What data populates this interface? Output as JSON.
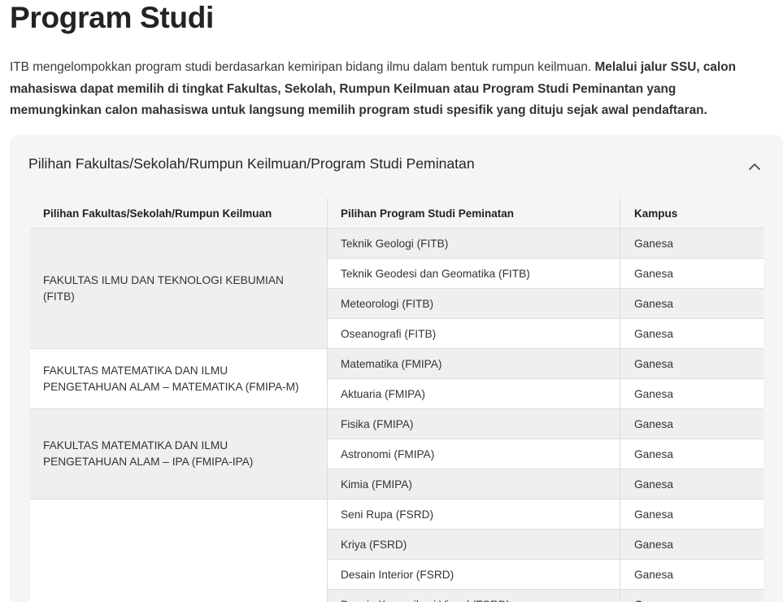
{
  "page_title": "Program Studi",
  "intro": {
    "normal": "ITB mengelompokkan program studi berdasarkan kemiripan bidang ilmu dalam bentuk rumpun keilmuan. ",
    "bold": "Melalui jalur SSU, calon mahasiswa dapat memilih di tingkat Fakultas, Sekolah, Rumpun Keilmuan atau Program Studi Peminantan yang memungkinkan calon mahasiswa untuk langsung memilih program studi spesifik yang dituju sejak awal pendaftaran."
  },
  "accordion": {
    "title": "Pilihan Fakultas/Sekolah/Rumpun Keilmuan/Program Studi Peminatan",
    "toggle_icon": "chevron-up-icon",
    "expanded": true
  },
  "table": {
    "headers": [
      "Pilihan Fakultas/Sekolah/Rumpun Keilmuan",
      "Pilihan Program Studi Peminatan",
      "Kampus"
    ],
    "faculties": [
      "FAKULTAS ILMU DAN TEKNOLOGI KEBUMIAN (FITB)",
      "FAKULTAS MATEMATIKA DAN ILMU PENGETAHUAN ALAM – MATEMATIKA (FMIPA-M)",
      "FAKULTAS MATEMATIKA DAN ILMU PENGETAHUAN ALAM – IPA (FMIPA-IPA)",
      ""
    ],
    "rows": [
      {
        "program": "Teknik Geologi (FITB)",
        "campus": "Ganesa"
      },
      {
        "program": "Teknik Geodesi dan Geomatika (FITB)",
        "campus": "Ganesa"
      },
      {
        "program": "Meteorologi (FITB)",
        "campus": "Ganesa"
      },
      {
        "program": "Oseanografi (FITB)",
        "campus": "Ganesa"
      },
      {
        "program": "Matematika (FMIPA)",
        "campus": "Ganesa"
      },
      {
        "program": "Aktuaria (FMIPA)",
        "campus": "Ganesa"
      },
      {
        "program": "Fisika (FMIPA)",
        "campus": "Ganesa"
      },
      {
        "program": "Astronomi (FMIPA)",
        "campus": "Ganesa"
      },
      {
        "program": "Kimia (FMIPA)",
        "campus": "Ganesa"
      },
      {
        "program": "Seni Rupa (FSRD)",
        "campus": "Ganesa"
      },
      {
        "program": "Kriya (FSRD)",
        "campus": "Ganesa"
      },
      {
        "program": "Desain Interior (FSRD)",
        "campus": "Ganesa"
      },
      {
        "program": "Desain Komunikasi Visual (FSRD)",
        "campus": "Ganesa"
      }
    ]
  }
}
